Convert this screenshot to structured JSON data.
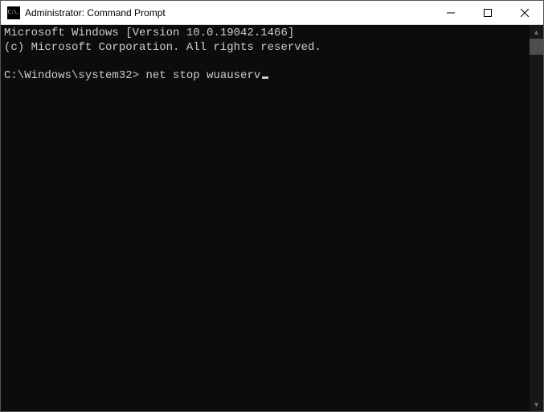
{
  "titlebar": {
    "title": "Administrator: Command Prompt",
    "icon_text": "C:\\."
  },
  "console": {
    "line1": "Microsoft Windows [Version 10.0.19042.1466]",
    "line2": "(c) Microsoft Corporation. All rights reserved.",
    "blank": "",
    "prompt": "C:\\Windows\\system32>",
    "command": "net stop wuauserv"
  }
}
